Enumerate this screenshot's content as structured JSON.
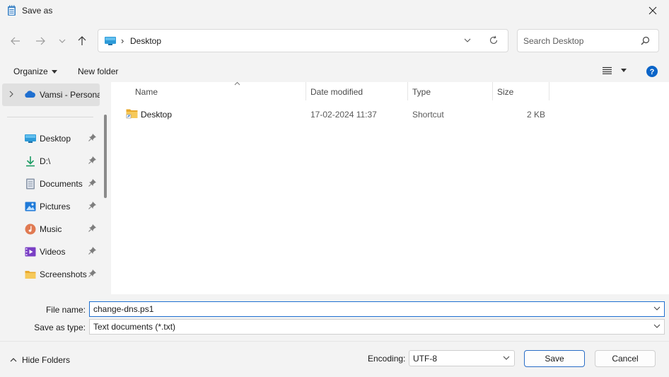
{
  "window": {
    "title": "Save as"
  },
  "address": {
    "location": "Desktop"
  },
  "search": {
    "placeholder": "Search Desktop"
  },
  "toolbar": {
    "organize_label": "Organize",
    "new_folder_label": "New folder"
  },
  "sidebar": {
    "top_item": "Vamsi - Persona",
    "items": [
      {
        "label": "Desktop",
        "icon": "desktop-icon"
      },
      {
        "label": "D:\\",
        "icon": "download-icon"
      },
      {
        "label": "Documents",
        "icon": "documents-icon"
      },
      {
        "label": "Pictures",
        "icon": "pictures-icon"
      },
      {
        "label": "Music",
        "icon": "music-icon"
      },
      {
        "label": "Videos",
        "icon": "videos-icon"
      },
      {
        "label": "Screenshots",
        "icon": "folder-icon"
      }
    ]
  },
  "columns": [
    "Name",
    "Date modified",
    "Type",
    "Size"
  ],
  "files": [
    {
      "name": "Desktop",
      "date": "17-02-2024 11:37",
      "type": "Shortcut",
      "size": "2 KB"
    }
  ],
  "form": {
    "file_name_label": "File name:",
    "file_name_value": "change-dns.ps1",
    "save_type_label": "Save as type:",
    "save_type_value": "Text documents (*.txt)"
  },
  "footer": {
    "hide_folders_label": "Hide Folders",
    "encoding_label": "Encoding:",
    "encoding_value": "UTF-8",
    "save_label": "Save",
    "cancel_label": "Cancel"
  },
  "colors": {
    "accent": "#1e6fd0",
    "help": "#0a64c8",
    "folder": "#f2c04f"
  }
}
